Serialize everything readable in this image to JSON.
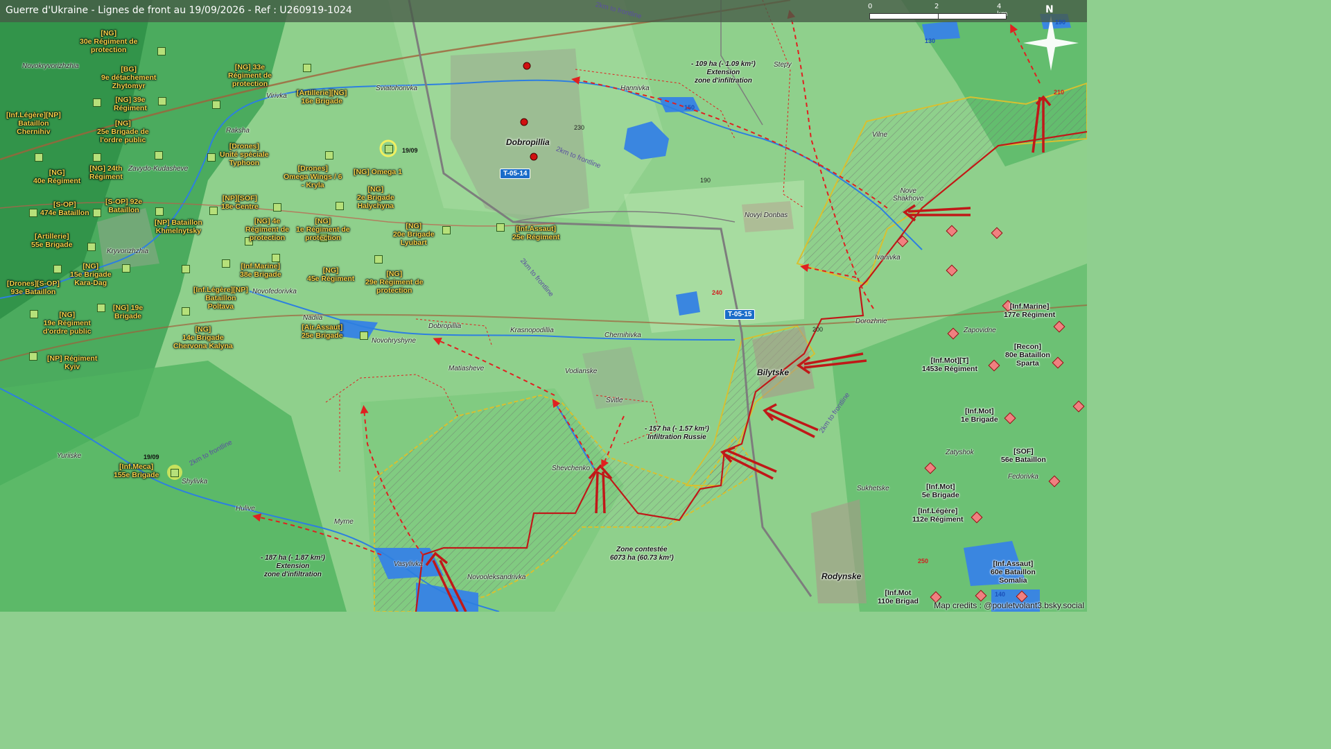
{
  "header": {
    "title": "Guerre d'Ukraine - Lignes de front au 19/09/2026 - Ref : U260919-1024",
    "scale_labels": [
      "0",
      "2",
      "4 km"
    ],
    "north_label": "N"
  },
  "road_labels": [
    "T-05-14",
    "T-05-15"
  ],
  "places": {
    "novokryvorizhzhia": "Novokryvorizhzhia",
    "virivka": "Virivka",
    "sviatohorivka": "Sviatohorivka",
    "raksha": "Raksha",
    "zavydo": "Zavydo-Kudasheve",
    "kryvorizhzhia": "Kryvorizhzhia",
    "novofedorivka": "Novofedorivka",
    "nadiia": "Nadiia",
    "novohryshyne": "Novohryshyne",
    "dobropillia_small": "Dobropillia",
    "krasnopodillia": "Krasnopodillia",
    "chernihivka": "Chernihivka",
    "matiasheve": "Matiasheve",
    "vodianske": "Vodianske",
    "svitle": "Svitle",
    "shevchenko": "Shevchenko",
    "yuriiske": "Yuriiske",
    "shylivka": "Shylivka",
    "hulive": "Hulive",
    "myrne": "Myrne",
    "vasylivka": "Vasylivka",
    "novooleksandrivka": "Novooleksandrivka",
    "hannivka": "Hannivka",
    "stepy": "Stepy",
    "vilne": "Vilne",
    "nove_shakhove": "Nove\nShakhove",
    "novyi_donbas": "Novyi Donbas",
    "ivanivka": "Ivanivka",
    "dorozhnie": "Dorozhnie",
    "zapovidne": "Zapovidne",
    "zatyshok": "Zatyshok",
    "fedorivka": "Fedorivka",
    "sukhetske": "Sukhetske"
  },
  "big_places": {
    "dobropillia": "Dobropillia",
    "bilytske": "Bilytske",
    "rodynske": "Rodynske"
  },
  "elevations": [
    "230",
    "190",
    "200",
    "150"
  ],
  "elevations_red": [
    "240",
    "210",
    "250"
  ],
  "elevations_blue": [
    "130",
    "190",
    "140"
  ],
  "frontline_labels": [
    "2km to frontline",
    "2km to frontline",
    "2km to frontline",
    "2km to frontline",
    "2km to frontline"
  ],
  "notes": {
    "infil_north": "- 109 ha (- 1.09 km²)\nExtension\nzone d'infiltration",
    "infil_center": "- 157 ha (- 1.57 km²)\nInfiltration Russie",
    "infil_south": "- 187 ha (- 1.87 km²)\nExtension\nzone d'infiltration",
    "contested": "Zone contestée\n6073 ha (60.73 km²)"
  },
  "dates": [
    "19/09",
    "19/09"
  ],
  "ua_units": [
    "[NG]\n30e Régiment de\nprotection",
    "[BG]\n9e détachement\nZhytomyr",
    "[NG] 33e\nRégiment de\nprotection",
    "[NG] 39e\nRégiment",
    "[Inf.Légère][NP]\nBataillon\nChernihiv",
    "[NG]\n25e Brigade de\nl'ordre public",
    "[Artillerie][NG]\n16e Brigade",
    "[Drones]\nUnité spéciale\nTyphoon",
    "[NG]\n40e Régiment",
    "[NG] 24th\nRégiment",
    "[Drones]\nOmega Wings / 6\n- Kryla",
    "[NG] Omega 1",
    "[S-OP]\n474e Bataillon",
    "[S-OP] 92e\nBataillon",
    "[NP][SOF]\n18e Centre",
    "[NG]\n2e Brigade\nHalychyna",
    "[Artillerie]\n55e Brigade",
    "[NP] Bataillon\nKhmelnytsky",
    "[NG] 4e\nRégiment de\nprotection",
    "[NG]\n1e Régiment de\nprotection",
    "[NG]\n20e Brigade\nLyubart",
    "[Inf.Assaut]\n25e Régiment",
    "[NG]\n15e Brigade\nKara-Dag",
    "[Inf.Marine]\n38e Brigade",
    "[NG]\n45e Régiment",
    "[Drones][S-OP]\n93e Bataillon",
    "[Inf.Légère][NP]\nBataillon\nPoltava",
    "[NG]\n29e Régiment de\nprotection",
    "[NG] 19e\nBrigade",
    "[NG]\n19e Régiment\nd'ordre public",
    "[NG]\n14e Brigade\nChervona Kalyna",
    "[Air.Assaut]\n25e Brigade",
    "[NP] Régiment\nKyiv",
    "[Inf.Meca]\n155e Brigade"
  ],
  "ru_units": [
    "[Inf.Marine]\n177e Régiment",
    "[Recon]\n80e Bataillon\nSparta",
    "[Inf.Mot][T]\n1453e Régiment",
    "[Inf.Mot]\n1e Brigade",
    "[SOF]\n56e Bataillon",
    "[Inf.Mot]\n5e Brigade",
    "[Inf.Légère]\n112e Régiment",
    "[Inf.Assaut]\n60e Bataillon\nSomalia",
    "[Inf.Mot\n110e Brigad"
  ],
  "credits": "Map credits : @pouletvolant3.bsky.social",
  "colors": {
    "ru_front": "#c01818",
    "contested_border": "#d8c030",
    "infiltration": "#e02020",
    "water": "#2d7fe0",
    "ua_unit_text": "#f6d24a"
  }
}
